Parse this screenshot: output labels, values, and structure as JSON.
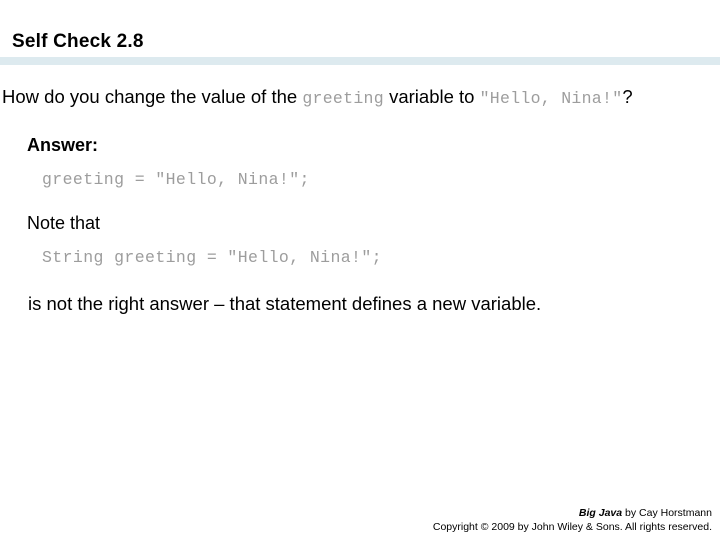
{
  "slide": {
    "title": "Self Check 2.8",
    "question": {
      "text_before_code": "How do you change the value of the ",
      "code_variable": "greeting",
      "text_after_code": " variable to ",
      "code_string": "\"Hello, Nina!\"",
      "text_end": "?"
    },
    "answer_label": "Answer:",
    "answer_code": "greeting = \"Hello, Nina!\";",
    "note_label": "Note that",
    "note_code": "String greeting = \"Hello, Nina!\";",
    "closing_text": "is not the right answer – that statement defines a new variable."
  },
  "footer": {
    "book_title": "Big Java",
    "author_line": " by Cay Horstmann",
    "copyright": "Copyright © 2009 by John Wiley & Sons.  All rights reserved."
  },
  "colors": {
    "rule": "#ddeaef",
    "code_text": "#9d9d9d",
    "body_text": "#000000"
  }
}
